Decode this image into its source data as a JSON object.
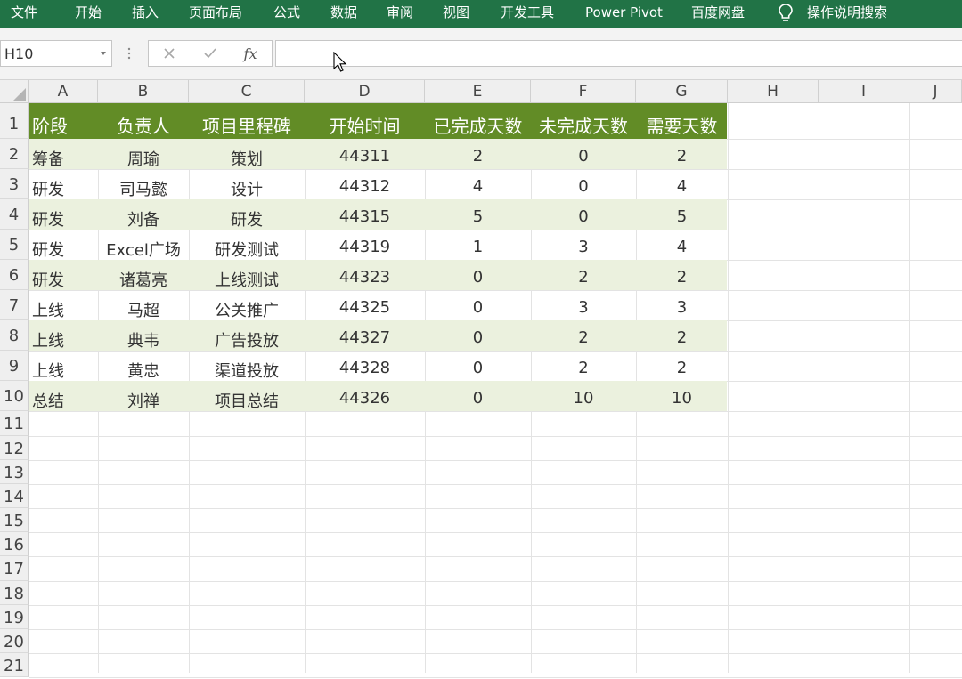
{
  "ribbon": {
    "tabs": [
      "文件",
      "开始",
      "插入",
      "页面布局",
      "公式",
      "数据",
      "审阅",
      "视图",
      "开发工具",
      "Power Pivot",
      "百度网盘"
    ],
    "tell_me": "操作说明搜索"
  },
  "formula_bar": {
    "name_box": "H10",
    "fx_label": "fx",
    "value": ""
  },
  "columns": [
    "A",
    "B",
    "C",
    "D",
    "E",
    "F",
    "G",
    "H",
    "I",
    "J"
  ],
  "rows": [
    "1",
    "2",
    "3",
    "4",
    "5",
    "6",
    "7",
    "8",
    "9",
    "10",
    "11",
    "12",
    "13",
    "14",
    "15",
    "16",
    "17",
    "18",
    "19",
    "20",
    "21"
  ],
  "table": {
    "headers": [
      "阶段",
      "负责人",
      "项目里程碑",
      "开始时间",
      "已完成天数",
      "未完成天数",
      "需要天数"
    ],
    "data": [
      [
        "筹备",
        "周瑜",
        "策划",
        "44311",
        "2",
        "0",
        "2"
      ],
      [
        "研发",
        "司马懿",
        "设计",
        "44312",
        "4",
        "0",
        "4"
      ],
      [
        "研发",
        "刘备",
        "研发",
        "44315",
        "5",
        "0",
        "5"
      ],
      [
        "研发",
        "Excel广场",
        "研发测试",
        "44319",
        "1",
        "3",
        "4"
      ],
      [
        "研发",
        "诸葛亮",
        "上线测试",
        "44323",
        "0",
        "2",
        "2"
      ],
      [
        "上线",
        "马超",
        "公关推广",
        "44325",
        "0",
        "3",
        "3"
      ],
      [
        "上线",
        "典韦",
        "广告投放",
        "44327",
        "0",
        "2",
        "2"
      ],
      [
        "上线",
        "黄忠",
        "渠道投放",
        "44328",
        "0",
        "2",
        "2"
      ],
      [
        "总结",
        "刘禅",
        "项目总结",
        "44326",
        "0",
        "10",
        "10"
      ]
    ]
  },
  "colors": {
    "ribbon": "#217346",
    "header_fill": "#628C26",
    "band_fill": "#EBF1DE"
  }
}
